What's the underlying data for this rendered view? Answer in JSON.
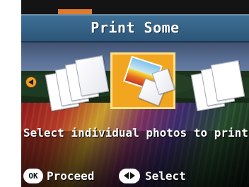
{
  "screen": {
    "title": "Print Some",
    "caption": "Select individual photos to print",
    "accent_color": "#e07a2c",
    "header_color": "#3f6f95",
    "selected_color": "#f2a620"
  },
  "navigation": {
    "left_arrow_icon": "left-arrow-icon"
  },
  "options": [
    {
      "name": "print-multiple-sheets-option",
      "icon": "stacked-sheets-icon"
    },
    {
      "name": "print-some-option",
      "icon": "selected-photo-icon"
    },
    {
      "name": "print-range-option",
      "icon": "stacked-sheets-icon"
    }
  ],
  "footer": {
    "ok_badge": "OK",
    "proceed_label": "Proceed",
    "select_icon": "left-right-arrow-icon",
    "select_label": "Select"
  }
}
